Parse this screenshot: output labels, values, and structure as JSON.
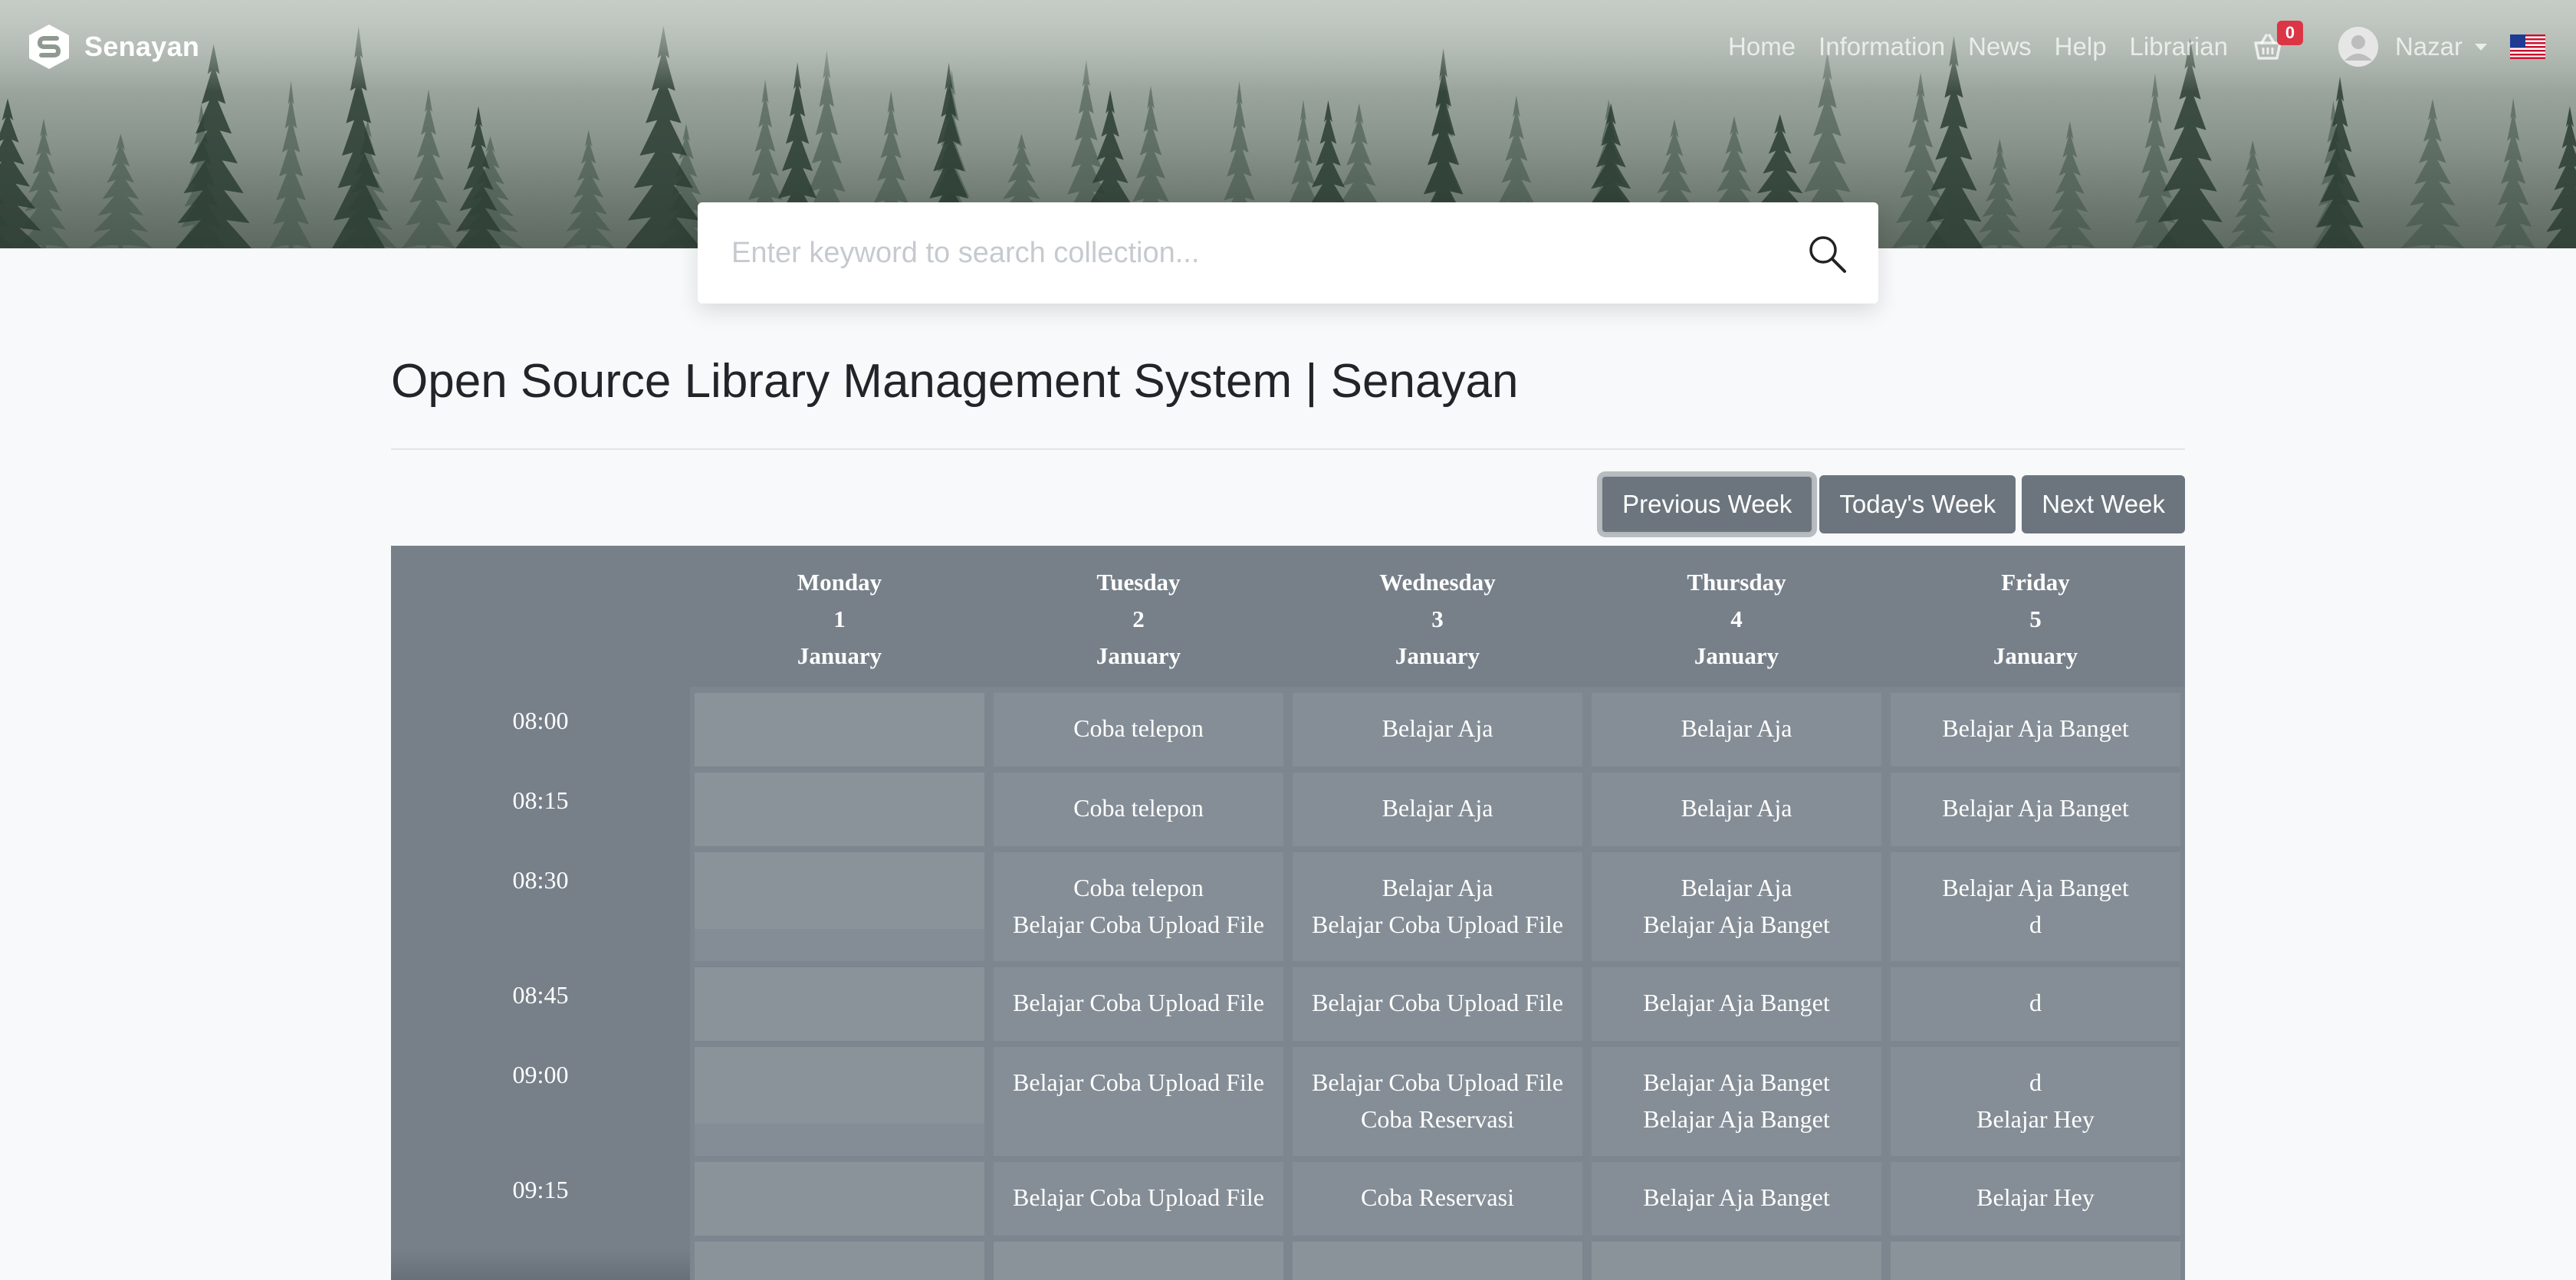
{
  "brand": {
    "name": "Senayan"
  },
  "nav": {
    "links": [
      "Home",
      "Information",
      "News",
      "Help",
      "Librarian"
    ],
    "cart_count": "0",
    "user_name": "Nazar"
  },
  "search": {
    "placeholder": "Enter keyword to search collection..."
  },
  "page": {
    "title": "Open Source Library Management System | Senayan"
  },
  "week_buttons": {
    "previous": "Previous Week",
    "today": "Today's Week",
    "next": "Next Week"
  },
  "colors": {
    "calendar_bg": "#778089",
    "button": "#6c757d",
    "badge": "#dc3545"
  },
  "calendar": {
    "days": [
      {
        "name": "Monday",
        "num": "1",
        "month": "January"
      },
      {
        "name": "Tuesday",
        "num": "2",
        "month": "January"
      },
      {
        "name": "Wednesday",
        "num": "3",
        "month": "January"
      },
      {
        "name": "Thursday",
        "num": "4",
        "month": "January"
      },
      {
        "name": "Friday",
        "num": "5",
        "month": "January"
      }
    ],
    "slots": [
      {
        "time": "08:00",
        "cells": [
          [],
          [
            "Coba telepon"
          ],
          [
            "Belajar Aja"
          ],
          [
            "Belajar Aja"
          ],
          [
            "Belajar Aja Banget"
          ]
        ]
      },
      {
        "time": "08:15",
        "cells": [
          [],
          [
            "Coba telepon"
          ],
          [
            "Belajar Aja"
          ],
          [
            "Belajar Aja"
          ],
          [
            "Belajar Aja Banget"
          ]
        ]
      },
      {
        "time": "08:30",
        "cells": [
          [],
          [
            "Coba telepon",
            "Belajar Coba Upload File"
          ],
          [
            "Belajar Aja",
            "Belajar Coba Upload File"
          ],
          [
            "Belajar Aja",
            "Belajar Aja Banget"
          ],
          [
            "Belajar Aja Banget",
            "d"
          ]
        ]
      },
      {
        "time": "08:45",
        "cells": [
          [],
          [
            "Belajar Coba Upload File"
          ],
          [
            "Belajar Coba Upload File"
          ],
          [
            "Belajar Aja Banget"
          ],
          [
            "d"
          ]
        ]
      },
      {
        "time": "09:00",
        "cells": [
          [],
          [
            "Belajar Coba Upload File"
          ],
          [
            "Belajar Coba Upload File",
            "Coba Reservasi"
          ],
          [
            "Belajar Aja Banget",
            "Belajar Aja Banget"
          ],
          [
            "d",
            "Belajar Hey"
          ]
        ]
      },
      {
        "time": "09:15",
        "cells": [
          [],
          [
            "Belajar Coba Upload File"
          ],
          [
            "Coba Reservasi"
          ],
          [
            "Belajar Aja Banget"
          ],
          [
            "Belajar Hey"
          ]
        ]
      },
      {
        "time": "",
        "cells": [
          [],
          [],
          [],
          [],
          []
        ]
      }
    ]
  }
}
